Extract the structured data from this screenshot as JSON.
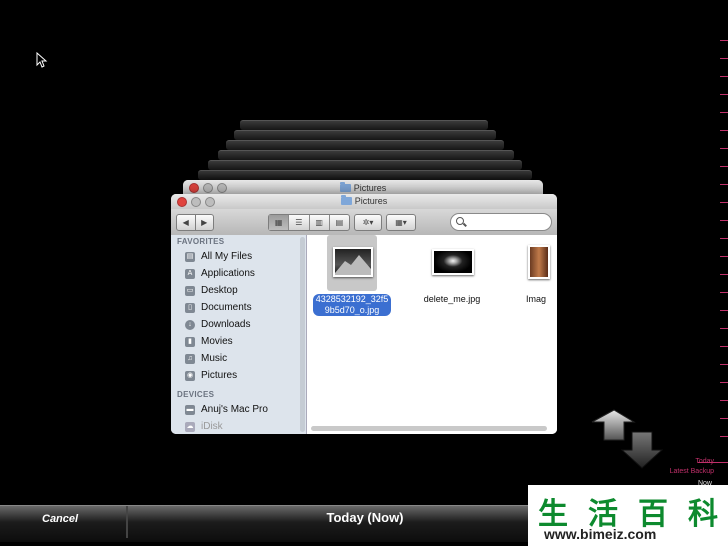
{
  "back_window": {
    "title": "Pictures"
  },
  "finder": {
    "title": "Pictures",
    "toolbar": {
      "back_glyph": "◀",
      "forward_glyph": "▶",
      "view_icons": [
        "icon-view-icon",
        "list-view-icon",
        "column-view-icon",
        "coverflow-view-icon"
      ],
      "action_glyph": "✲▾",
      "arrange_glyph": "▦▾",
      "search_placeholder": ""
    },
    "sidebar": {
      "favorites_header": "FAVORITES",
      "favorites": [
        {
          "label": "All My Files",
          "icon": "all-files-icon"
        },
        {
          "label": "Applications",
          "icon": "applications-icon"
        },
        {
          "label": "Desktop",
          "icon": "desktop-icon"
        },
        {
          "label": "Documents",
          "icon": "documents-icon"
        },
        {
          "label": "Downloads",
          "icon": "downloads-icon"
        },
        {
          "label": "Movies",
          "icon": "movies-icon"
        },
        {
          "label": "Music",
          "icon": "music-icon"
        },
        {
          "label": "Pictures",
          "icon": "pictures-icon"
        }
      ],
      "devices_header": "DEVICES",
      "devices": [
        {
          "label": "Anuj's Mac Pro",
          "icon": "computer-icon"
        },
        {
          "label": "iDisk",
          "icon": "idisk-icon"
        }
      ]
    },
    "files": [
      {
        "name_line1": "4328532192_32f5",
        "name_line2": "9b5d70_o.jpg",
        "selected": true
      },
      {
        "name_line1": "delete_me.jpg",
        "name_line2": "",
        "selected": false
      },
      {
        "name_line1": "Imag",
        "name_line2": "",
        "selected": false
      }
    ]
  },
  "timeline": {
    "today": "Today",
    "latest_backup": "Latest Backup",
    "now": "Now"
  },
  "bottom_bar": {
    "cancel_label": "Cancel",
    "title": "Today (Now)"
  },
  "watermark": {
    "chars": [
      "生",
      "活",
      "百",
      "科"
    ],
    "url": "www.bimeiz.com"
  },
  "colors": {
    "selection": "#3b6fd1",
    "timeline_accent": "#c0306a",
    "watermark_green": "#0d8a2e"
  }
}
